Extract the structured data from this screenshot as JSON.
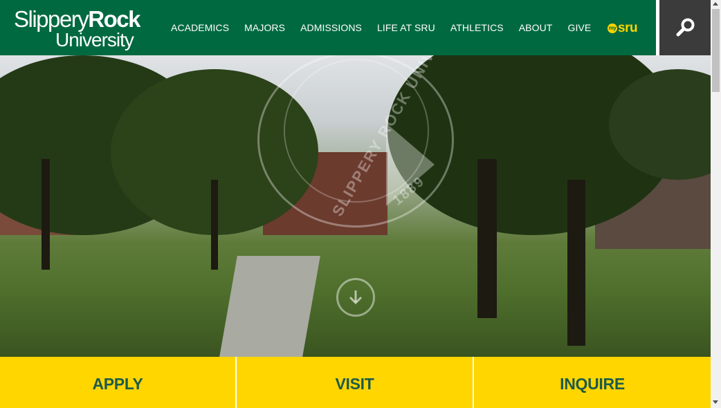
{
  "logo": {
    "line1_regular": "Slippery",
    "line1_bold": "Rock",
    "line2": "University"
  },
  "nav": {
    "items": [
      "ACADEMICS",
      "MAJORS",
      "ADMISSIONS",
      "LIFE AT SRU",
      "ATHLETICS",
      "ABOUT",
      "GIVE"
    ],
    "mysru_prefix": "my",
    "mysru_label": "sru"
  },
  "hero": {
    "seal_text": "SLIPPERY ROCK UNIVERSITY",
    "seal_year": "1889"
  },
  "cta": {
    "apply": "APPLY",
    "visit": "VISIT",
    "inquire": "INQUIRE"
  },
  "colors": {
    "header_green": "#006940",
    "cta_yellow": "#ffd600",
    "cta_text": "#1d5a4a",
    "search_bg": "#3b3b3b"
  },
  "icons": {
    "search": "search-icon",
    "play": "play-icon",
    "scroll_down": "chevron-down-icon"
  }
}
